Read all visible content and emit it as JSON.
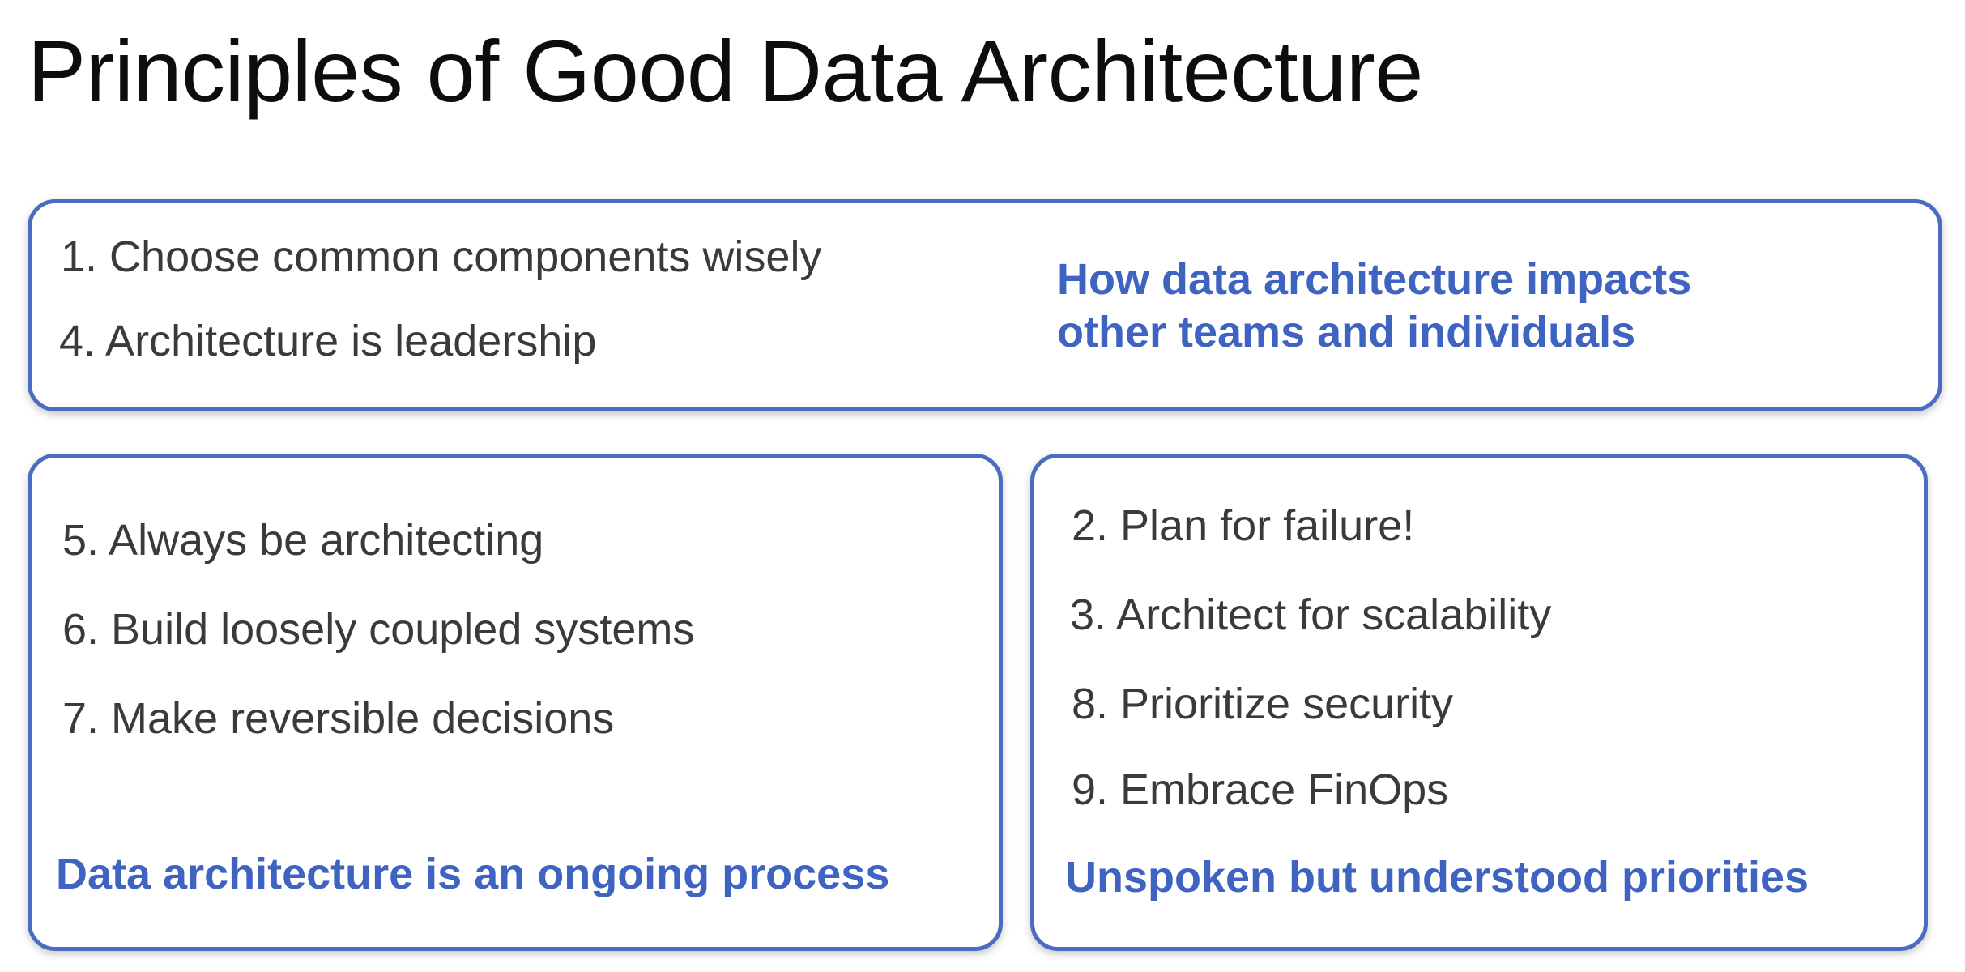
{
  "slide": {
    "title": "Principles of Good Data Architecture"
  },
  "top_box": {
    "items": [
      "1. Choose common components wisely",
      "4. Architecture is leadership"
    ],
    "caption": "How data architecture impacts other teams and individuals"
  },
  "left_box": {
    "items": [
      "5. Always be architecting",
      "6. Build loosely coupled systems",
      "7. Make reversible decisions"
    ],
    "caption": "Data architecture is an ongoing process"
  },
  "right_box": {
    "items": [
      "2. Plan for failure!",
      "3. Architect for scalability",
      "8. Prioritize security",
      "9. Embrace FinOps"
    ],
    "caption": "Unspoken but understood priorities"
  },
  "colors": {
    "accent": "#3f63c0",
    "border": "#4a6cc2",
    "body_text": "#3a3a3a",
    "title_text": "#0d0d0d"
  }
}
